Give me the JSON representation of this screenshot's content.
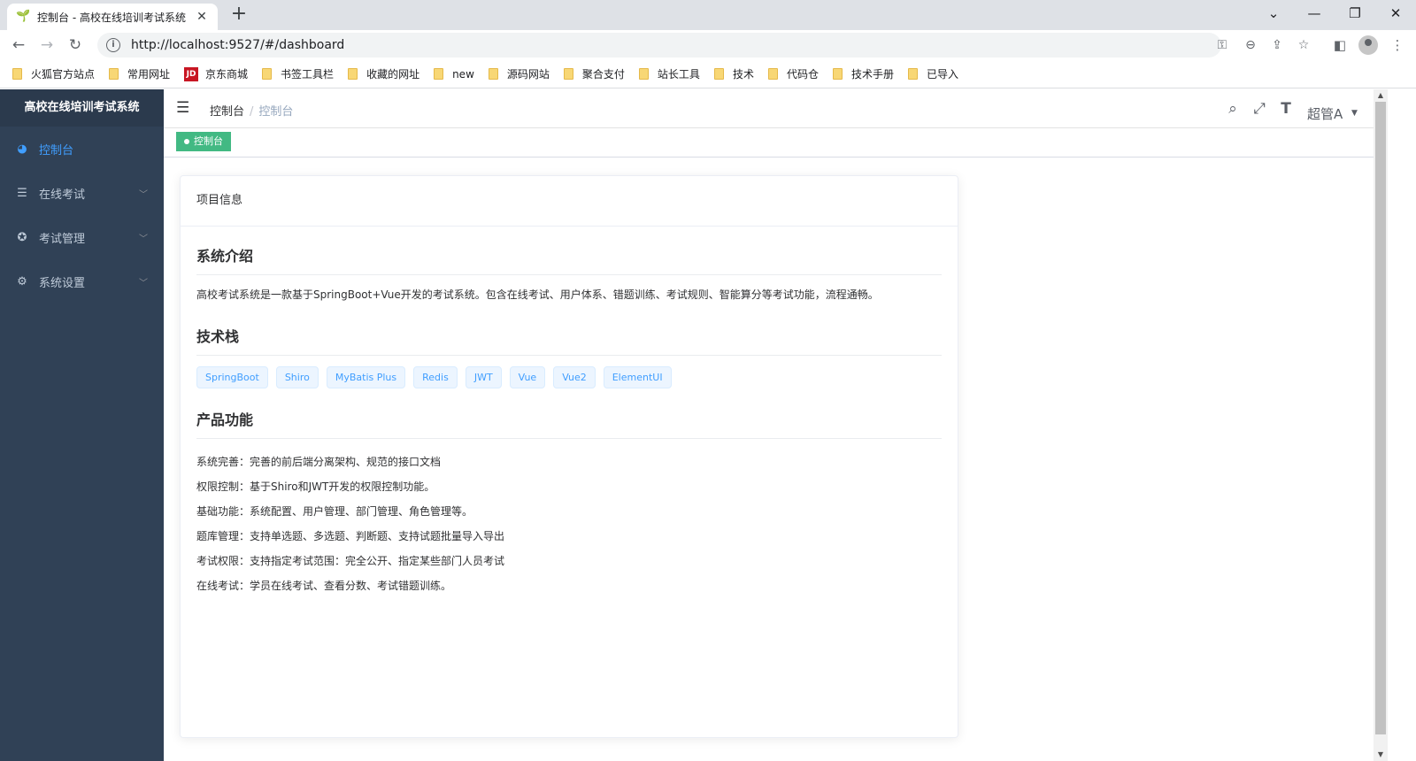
{
  "browser": {
    "tab_title": "控制台 - 高校在线培训考试系统",
    "url": "http://localhost:9527/#/dashboard",
    "bookmarks": [
      "火狐官方站点",
      "常用网址",
      "京东商城",
      "书签工具栏",
      "收藏的网址",
      "new",
      "源码网站",
      "聚合支付",
      "站长工具",
      "技术",
      "代码仓",
      "技术手册",
      "已导入"
    ]
  },
  "sidebar": {
    "logo": "高校在线培训考试系统",
    "items": [
      {
        "label": "控制台",
        "icon": "dashboard-icon"
      },
      {
        "label": "在线考试",
        "icon": "list-icon"
      },
      {
        "label": "考试管理",
        "icon": "exam-icon"
      },
      {
        "label": "系统设置",
        "icon": "gear-icon"
      }
    ]
  },
  "navbar": {
    "breadcrumb": [
      "控制台",
      "控制台"
    ],
    "separator": "/",
    "user": "超管A"
  },
  "tags": {
    "active": "控制台"
  },
  "card": {
    "header": "项目信息",
    "intro_title": "系统介绍",
    "intro_text": "高校考试系统是一款基于SpringBoot+Vue开发的考试系统。包含在线考试、用户体系、错题训练、考试规则、智能算分等考试功能，流程通畅。",
    "tech_title": "技术栈",
    "tech": [
      "SpringBoot",
      "Shiro",
      "MyBatis Plus",
      "Redis",
      "JWT",
      "Vue",
      "Vue2",
      "ElementUI"
    ],
    "features_title": "产品功能",
    "features": [
      "系统完善：完善的前后端分离架构、规范的接口文档",
      "权限控制：基于Shiro和JWT开发的权限控制功能。",
      "基础功能：系统配置、用户管理、部门管理、角色管理等。",
      "题库管理：支持单选题、多选题、判断题、支持试题批量导入导出",
      "考试权限：支持指定考试范围：完全公开、指定某些部门人员考试",
      "在线考试：学员在线考试、查看分数、考试错题训练。"
    ]
  },
  "colors": {
    "sidebar_bg": "#304156",
    "active": "#409eff",
    "tag_active": "#42b983"
  }
}
